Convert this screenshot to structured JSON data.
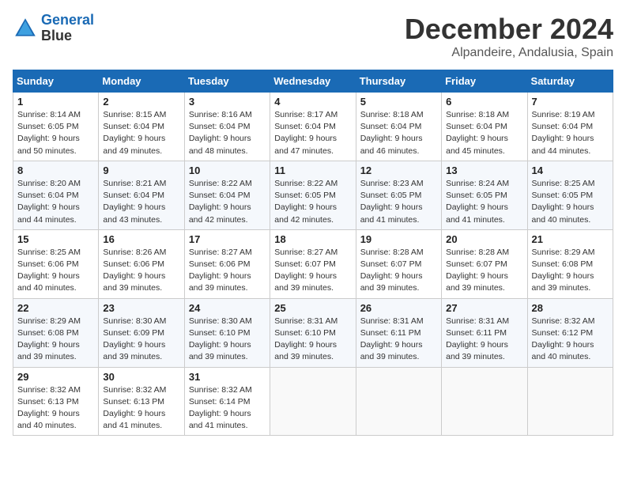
{
  "header": {
    "logo_line1": "General",
    "logo_line2": "Blue",
    "month": "December 2024",
    "location": "Alpandeire, Andalusia, Spain"
  },
  "weekdays": [
    "Sunday",
    "Monday",
    "Tuesday",
    "Wednesday",
    "Thursday",
    "Friday",
    "Saturday"
  ],
  "weeks": [
    [
      {
        "day": "1",
        "info": "Sunrise: 8:14 AM\nSunset: 6:05 PM\nDaylight: 9 hours\nand 50 minutes."
      },
      {
        "day": "2",
        "info": "Sunrise: 8:15 AM\nSunset: 6:04 PM\nDaylight: 9 hours\nand 49 minutes."
      },
      {
        "day": "3",
        "info": "Sunrise: 8:16 AM\nSunset: 6:04 PM\nDaylight: 9 hours\nand 48 minutes."
      },
      {
        "day": "4",
        "info": "Sunrise: 8:17 AM\nSunset: 6:04 PM\nDaylight: 9 hours\nand 47 minutes."
      },
      {
        "day": "5",
        "info": "Sunrise: 8:18 AM\nSunset: 6:04 PM\nDaylight: 9 hours\nand 46 minutes."
      },
      {
        "day": "6",
        "info": "Sunrise: 8:18 AM\nSunset: 6:04 PM\nDaylight: 9 hours\nand 45 minutes."
      },
      {
        "day": "7",
        "info": "Sunrise: 8:19 AM\nSunset: 6:04 PM\nDaylight: 9 hours\nand 44 minutes."
      }
    ],
    [
      {
        "day": "8",
        "info": "Sunrise: 8:20 AM\nSunset: 6:04 PM\nDaylight: 9 hours\nand 44 minutes."
      },
      {
        "day": "9",
        "info": "Sunrise: 8:21 AM\nSunset: 6:04 PM\nDaylight: 9 hours\nand 43 minutes."
      },
      {
        "day": "10",
        "info": "Sunrise: 8:22 AM\nSunset: 6:04 PM\nDaylight: 9 hours\nand 42 minutes."
      },
      {
        "day": "11",
        "info": "Sunrise: 8:22 AM\nSunset: 6:05 PM\nDaylight: 9 hours\nand 42 minutes."
      },
      {
        "day": "12",
        "info": "Sunrise: 8:23 AM\nSunset: 6:05 PM\nDaylight: 9 hours\nand 41 minutes."
      },
      {
        "day": "13",
        "info": "Sunrise: 8:24 AM\nSunset: 6:05 PM\nDaylight: 9 hours\nand 41 minutes."
      },
      {
        "day": "14",
        "info": "Sunrise: 8:25 AM\nSunset: 6:05 PM\nDaylight: 9 hours\nand 40 minutes."
      }
    ],
    [
      {
        "day": "15",
        "info": "Sunrise: 8:25 AM\nSunset: 6:06 PM\nDaylight: 9 hours\nand 40 minutes."
      },
      {
        "day": "16",
        "info": "Sunrise: 8:26 AM\nSunset: 6:06 PM\nDaylight: 9 hours\nand 39 minutes."
      },
      {
        "day": "17",
        "info": "Sunrise: 8:27 AM\nSunset: 6:06 PM\nDaylight: 9 hours\nand 39 minutes."
      },
      {
        "day": "18",
        "info": "Sunrise: 8:27 AM\nSunset: 6:07 PM\nDaylight: 9 hours\nand 39 minutes."
      },
      {
        "day": "19",
        "info": "Sunrise: 8:28 AM\nSunset: 6:07 PM\nDaylight: 9 hours\nand 39 minutes."
      },
      {
        "day": "20",
        "info": "Sunrise: 8:28 AM\nSunset: 6:07 PM\nDaylight: 9 hours\nand 39 minutes."
      },
      {
        "day": "21",
        "info": "Sunrise: 8:29 AM\nSunset: 6:08 PM\nDaylight: 9 hours\nand 39 minutes."
      }
    ],
    [
      {
        "day": "22",
        "info": "Sunrise: 8:29 AM\nSunset: 6:08 PM\nDaylight: 9 hours\nand 39 minutes."
      },
      {
        "day": "23",
        "info": "Sunrise: 8:30 AM\nSunset: 6:09 PM\nDaylight: 9 hours\nand 39 minutes."
      },
      {
        "day": "24",
        "info": "Sunrise: 8:30 AM\nSunset: 6:10 PM\nDaylight: 9 hours\nand 39 minutes."
      },
      {
        "day": "25",
        "info": "Sunrise: 8:31 AM\nSunset: 6:10 PM\nDaylight: 9 hours\nand 39 minutes."
      },
      {
        "day": "26",
        "info": "Sunrise: 8:31 AM\nSunset: 6:11 PM\nDaylight: 9 hours\nand 39 minutes."
      },
      {
        "day": "27",
        "info": "Sunrise: 8:31 AM\nSunset: 6:11 PM\nDaylight: 9 hours\nand 39 minutes."
      },
      {
        "day": "28",
        "info": "Sunrise: 8:32 AM\nSunset: 6:12 PM\nDaylight: 9 hours\nand 40 minutes."
      }
    ],
    [
      {
        "day": "29",
        "info": "Sunrise: 8:32 AM\nSunset: 6:13 PM\nDaylight: 9 hours\nand 40 minutes."
      },
      {
        "day": "30",
        "info": "Sunrise: 8:32 AM\nSunset: 6:13 PM\nDaylight: 9 hours\nand 41 minutes."
      },
      {
        "day": "31",
        "info": "Sunrise: 8:32 AM\nSunset: 6:14 PM\nDaylight: 9 hours\nand 41 minutes."
      },
      null,
      null,
      null,
      null
    ]
  ]
}
